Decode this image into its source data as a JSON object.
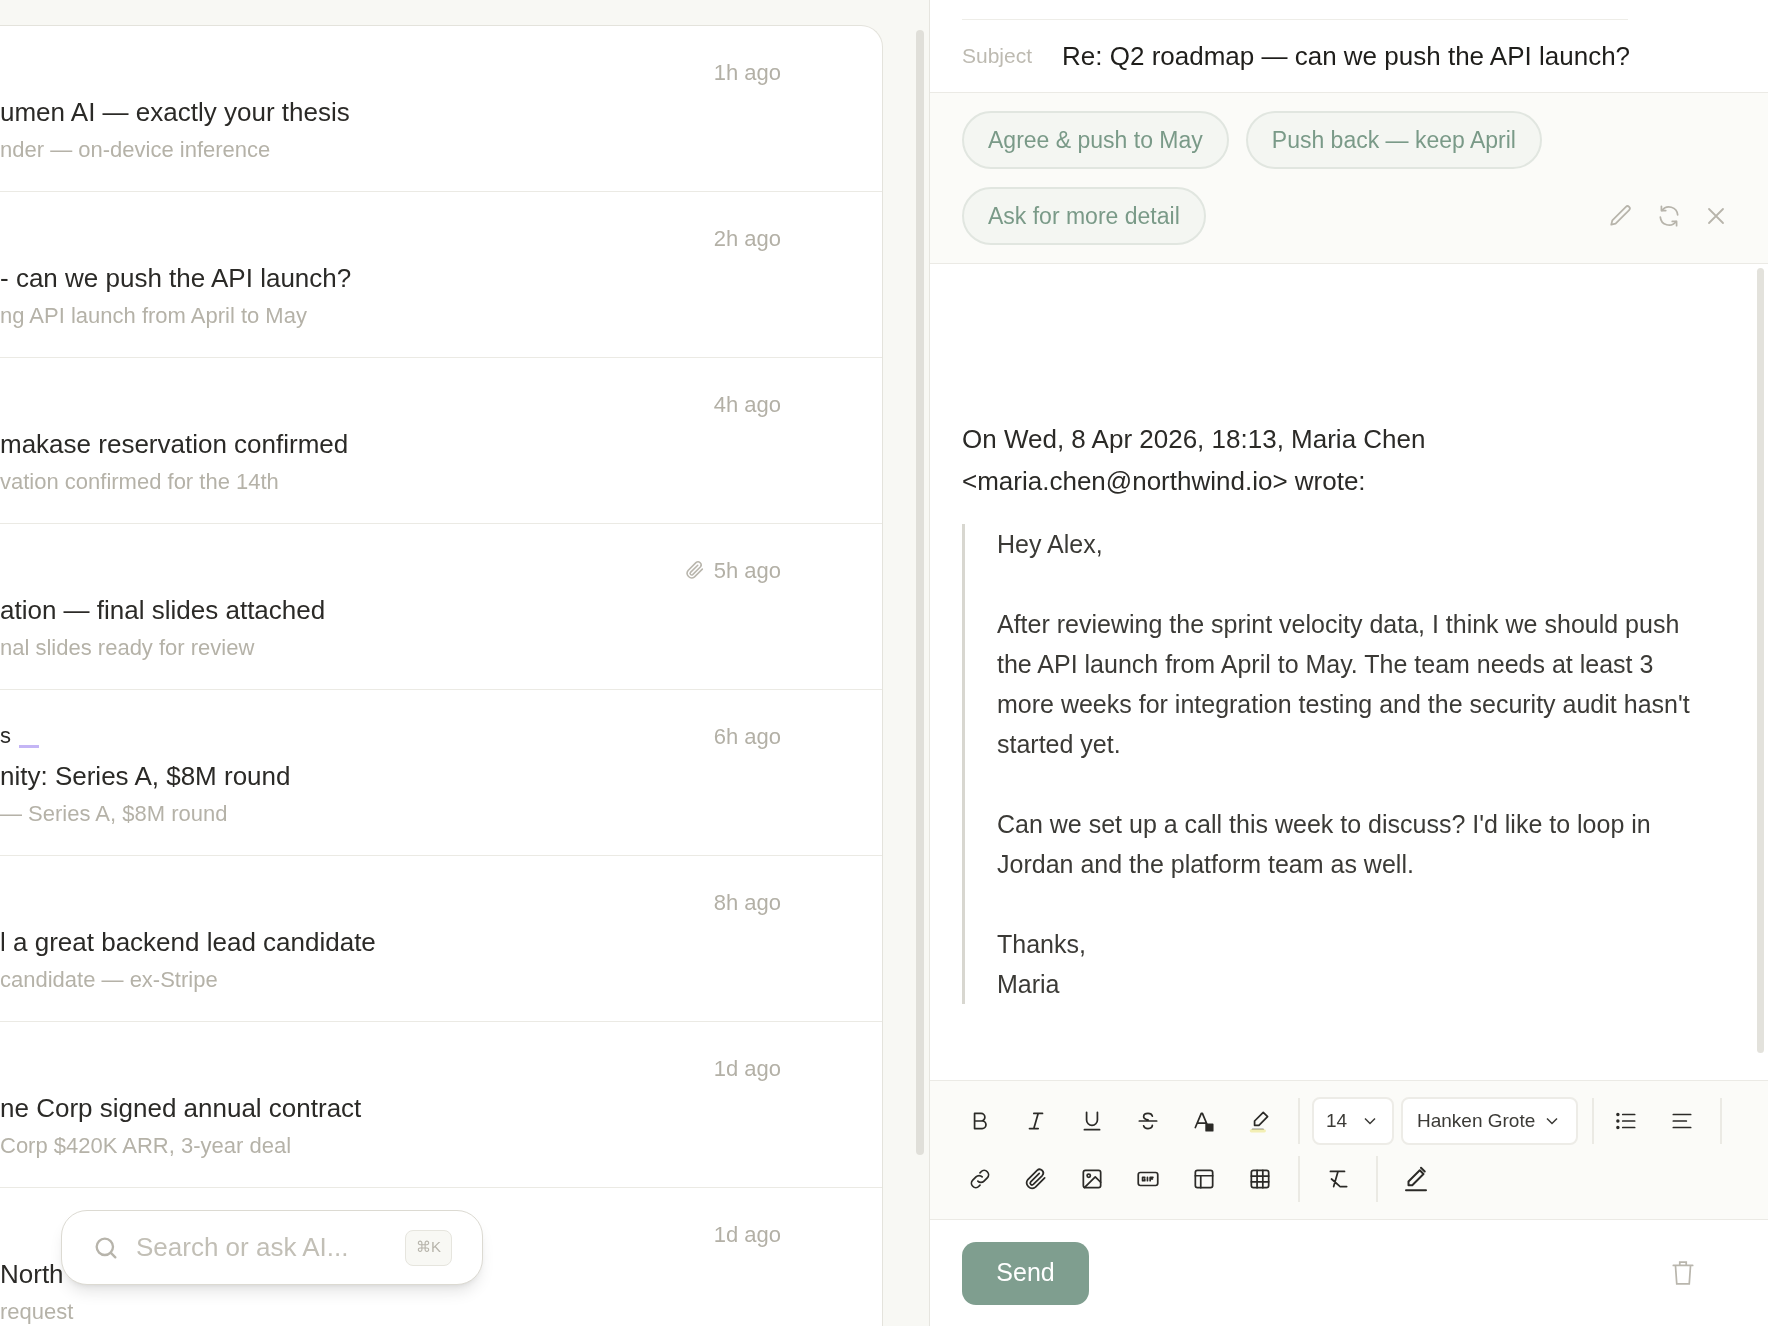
{
  "messages": [
    {
      "title": "umen AI — exactly your thesis",
      "preview": "nder — on-device inference",
      "time": "1h ago",
      "attachment": false
    },
    {
      "title": "- can we push the API launch?",
      "preview": "ng API launch from April to May",
      "time": "2h ago",
      "attachment": false
    },
    {
      "title": "makase reservation confirmed",
      "preview": "vation confirmed for the 14th",
      "time": "4h ago",
      "attachment": false
    },
    {
      "title": "ation — final slides attached",
      "preview": "nal slides ready for review",
      "time": "5h ago",
      "attachment": true
    },
    {
      "sender": "s",
      "color": "#c4b5f5",
      "title": "nity: Series A, $8M round",
      "preview": "— Series A, $8M round",
      "time": "6h ago",
      "attachment": false
    },
    {
      "title": "l a great backend lead candidate",
      "preview": "candidate — ex-Stripe",
      "time": "8h ago",
      "attachment": false
    },
    {
      "title": "ne Corp signed annual contract",
      "preview": "Corp $420K ARR, 3-year deal",
      "time": "1d ago",
      "attachment": false
    },
    {
      "title": "North",
      "preview": "request",
      "time": "1d ago",
      "attachment": false
    }
  ],
  "search": {
    "placeholder": "Search or ask AI...",
    "shortcut": "⌘K"
  },
  "compose": {
    "subject_label": "Subject",
    "subject": "Re: Q2 roadmap — can we push the API launch?",
    "suggestions": [
      "Agree & push to May",
      "Push back — keep April",
      "Ask for more detail"
    ],
    "quote_header": [
      "On Wed, 8 Apr 2026, 18:13, Maria Chen",
      "<maria.chen@northwind.io> wrote:"
    ],
    "quote": [
      {
        "lines": [
          "Hey Alex,"
        ]
      },
      {
        "lines": [
          "After reviewing the sprint velocity data, I think we should push the API launch from April to May. The team needs at least 3 more weeks for integration testing and the security audit hasn't started yet."
        ]
      },
      {
        "lines": [
          "Can we set up a call this week to discuss? I'd like to loop in Jordan and the platform team as well."
        ]
      },
      {
        "lines": [
          "Thanks,",
          "Maria"
        ]
      }
    ],
    "font_size": "14",
    "font": "Hanken Grote",
    "send": "Send"
  }
}
